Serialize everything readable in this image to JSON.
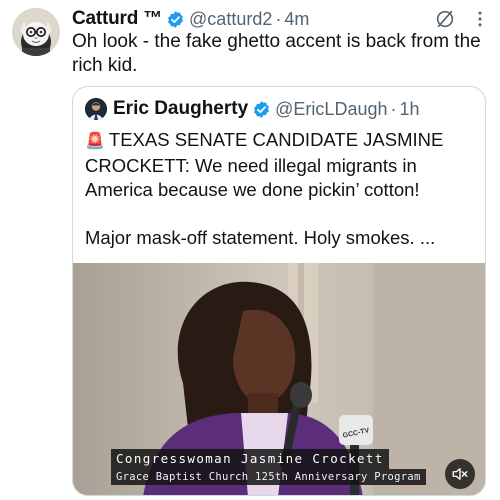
{
  "colors": {
    "verified_badge": "#1d9bf0",
    "secondary_text": "#536471",
    "primary_text": "#0f1419",
    "quote_border": "#cfd9de",
    "blazer": "#5b2d7a"
  },
  "post": {
    "author_name": "Catturd ™",
    "handle": "@catturd2",
    "separator": "·",
    "time": "4m",
    "text": "Oh look - the fake ghetto accent is back from the rich kid.",
    "icons": [
      "verified-badge-icon",
      "grok-icon",
      "more-options-icon"
    ]
  },
  "quoted_post": {
    "author_name": "Eric Daugherty",
    "handle": "@EricLDaugh",
    "separator": "·",
    "time": "1h",
    "siren_emoji": "🚨",
    "text_line1": "TEXAS SENATE CANDIDATE JASMINE CROCKETT: We need illegal migrants in America because we done pickin’ cotton!",
    "text_line2": "Major mask-off statement. Holy smokes. ...",
    "media": {
      "caption_name": "Congresswoman Jasmine Crockett",
      "caption_sub": "Grace Baptist Church 125th Anniversary Program",
      "mic_label": "GCC-TV",
      "icons": [
        "mute-icon"
      ]
    }
  }
}
